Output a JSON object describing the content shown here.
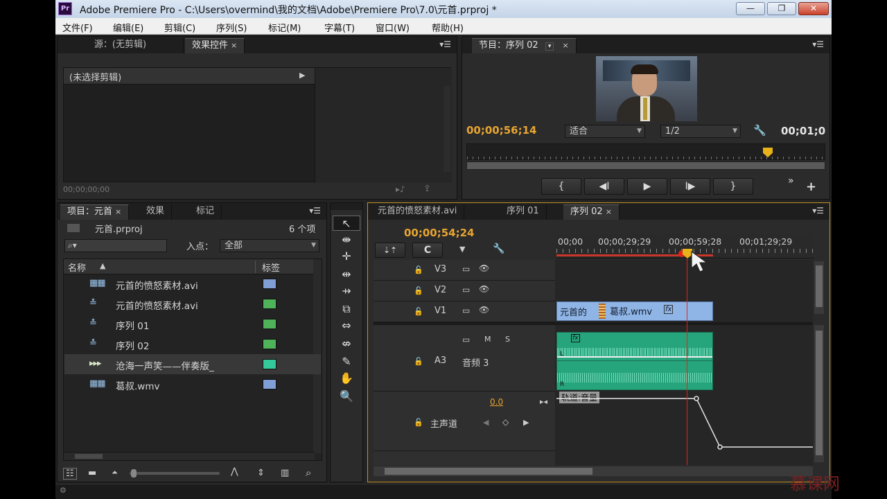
{
  "app": {
    "logo": "Pr",
    "title": "Adobe Premiere Pro - C:\\Users\\overmind\\我的文档\\Adobe\\Premiere Pro\\7.0\\元首.prproj *",
    "window_buttons": {
      "minimize": "—",
      "maximize": "❐",
      "close": "✕"
    }
  },
  "menu": [
    "文件(F)",
    "编辑(E)",
    "剪辑(C)",
    "序列(S)",
    "标记(M)",
    "字幕(T)",
    "窗口(W)",
    "帮助(H)"
  ],
  "source_panel": {
    "tabs": [
      {
        "label": "源：(无剪辑)",
        "active": false
      },
      {
        "label": "效果控件",
        "active": true,
        "close": "×"
      }
    ],
    "menu_icon": "▾☰",
    "no_clip": "(未选择剪辑)",
    "play_arrow": "▶",
    "timecode": "00;00;00;00",
    "footer_icons": [
      "▸♪",
      "⇪"
    ]
  },
  "program_monitor": {
    "tab": "节目：序列 02",
    "tab_arrow": "▾",
    "close": "×",
    "menu_icon": "▾☰",
    "current_timecode": "00;00;56;14",
    "fit": "适合",
    "resolution": "1/2",
    "duration": "00;01;0",
    "wrench_icon": "🔧",
    "buttons": [
      "{",
      "◀I",
      "▶",
      "I▶",
      "}"
    ],
    "extra_buttons": [
      "»",
      "+"
    ]
  },
  "project_panel": {
    "tabs": [
      {
        "label": "项目：元首",
        "active": true,
        "close": "×"
      },
      {
        "label": "效果",
        "active": false
      },
      {
        "label": "标记",
        "active": false
      }
    ],
    "menu_icon": "▾☰",
    "project_file": "元首.prproj",
    "item_count": "6 个项",
    "search_icon": "⌕▾",
    "in_point_label": "入点：",
    "in_point_value": "全部",
    "col_name": "名称",
    "sort_arrow": "▲",
    "col_label": "标签",
    "items": [
      {
        "icon": "▦▦",
        "name": "元首的愤怒素材.avi",
        "color": "#7f9fd6"
      },
      {
        "icon": "≛",
        "name": "元首的愤怒素材.avi",
        "color": "#4fb35a"
      },
      {
        "icon": "≛",
        "name": "序列 01",
        "color": "#4fb35a"
      },
      {
        "icon": "≛",
        "name": "序列 02",
        "color": "#4fb35a"
      },
      {
        "icon": "▸▸▸",
        "name": "沧海一声笑——伴奏版_",
        "color": "#34c99a",
        "selected": true
      },
      {
        "icon": "▦▦",
        "name": "葛叔.wmv",
        "color": "#7f9fd6"
      }
    ],
    "footer_icons": [
      "☷",
      "▬",
      "⏶",
      "⋀",
      "⇕",
      "▥",
      "⌕"
    ]
  },
  "tools": [
    "↖",
    "⇼",
    "✛",
    "⇹",
    "⇸",
    "⧉",
    "⇔",
    "⇎",
    "✎",
    "✋",
    "🔍"
  ],
  "timeline": {
    "tabs": [
      {
        "label": "元首的愤怒素材.avi",
        "active": false
      },
      {
        "label": "序列 01",
        "active": false
      },
      {
        "label": "序列 02",
        "active": true,
        "close": "×"
      }
    ],
    "menu_icon": "▾☰",
    "timecode": "00;00;54;24",
    "tool_buttons": [
      "⇣⇡",
      "C",
      "▼",
      "🔧"
    ],
    "ruler_labels": [
      "00;00",
      "00;00;29;29",
      "00;00;59;28",
      "00;01;29;29"
    ],
    "tracks": {
      "v3": "V3",
      "v2": "V2",
      "v1": "V1",
      "a3": "A3",
      "audio_name": "音频 3",
      "m": "M",
      "s": "S",
      "master": "主声道",
      "volume": "0.0",
      "lock_icon": "🔓",
      "eye_icon": "👁",
      "film_icon": "▭"
    },
    "clips": {
      "v1_a": "元首的",
      "v1_b": "葛叔.wmv",
      "fx": "fx",
      "audio_fx": "fx",
      "audio_L": "L",
      "audio_R": "R",
      "master_label": "轨道:音量"
    }
  },
  "watermark": "慕课网"
}
